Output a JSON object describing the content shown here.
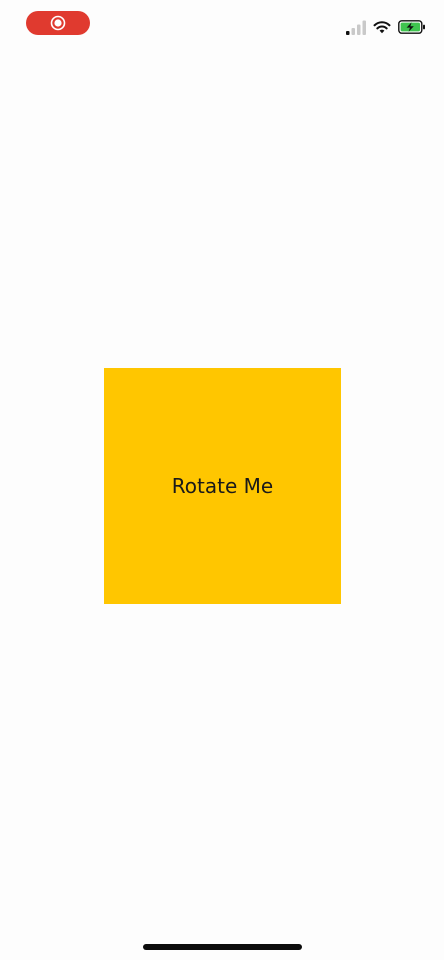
{
  "status_bar": {
    "recording_indicator": {
      "icon": "record-icon",
      "color": "#e03a2f"
    },
    "signal_icon": "signal-icon",
    "wifi_icon": "wifi-icon",
    "battery_icon": "battery-charging-icon",
    "battery_color": "#3fc44f"
  },
  "main": {
    "box_label": "Rotate Me",
    "box_color": "#ffc600"
  }
}
